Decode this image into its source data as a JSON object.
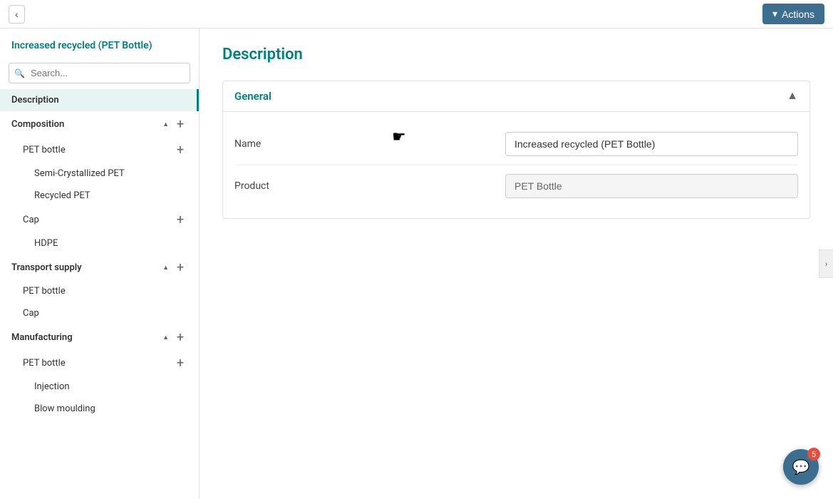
{
  "topbar": {
    "back_label": "‹",
    "actions_label": "Actions",
    "actions_icon": "▾"
  },
  "sidebar": {
    "title": "Increased recycled (PET Bottle)",
    "search_placeholder": "Search...",
    "nav": [
      {
        "id": "description",
        "label": "Description",
        "level": 0,
        "active": true,
        "has_plus": false,
        "chevron": null
      },
      {
        "id": "composition",
        "label": "Composition",
        "level": 0,
        "active": false,
        "has_plus": true,
        "chevron": "up"
      },
      {
        "id": "pet-bottle-1",
        "label": "PET bottle",
        "level": 1,
        "active": false,
        "has_plus": true,
        "chevron": null
      },
      {
        "id": "semi-crystallized-pet",
        "label": "Semi-Crystallized PET",
        "level": 2,
        "active": false,
        "has_plus": false,
        "chevron": null
      },
      {
        "id": "recycled-pet",
        "label": "Recycled PET",
        "level": 2,
        "active": false,
        "has_plus": false,
        "chevron": null
      },
      {
        "id": "cap-1",
        "label": "Cap",
        "level": 1,
        "active": false,
        "has_plus": true,
        "chevron": null
      },
      {
        "id": "hdpe",
        "label": "HDPE",
        "level": 2,
        "active": false,
        "has_plus": false,
        "chevron": null
      },
      {
        "id": "transport-supply",
        "label": "Transport supply",
        "level": 0,
        "active": false,
        "has_plus": true,
        "chevron": "up"
      },
      {
        "id": "pet-bottle-2",
        "label": "PET bottle",
        "level": 1,
        "active": false,
        "has_plus": false,
        "chevron": null
      },
      {
        "id": "cap-2",
        "label": "Cap",
        "level": 1,
        "active": false,
        "has_plus": false,
        "chevron": null
      },
      {
        "id": "manufacturing",
        "label": "Manufacturing",
        "level": 0,
        "active": false,
        "has_plus": true,
        "chevron": "up"
      },
      {
        "id": "pet-bottle-3",
        "label": "PET bottle",
        "level": 1,
        "active": false,
        "has_plus": true,
        "chevron": null
      },
      {
        "id": "injection",
        "label": "Injection",
        "level": 2,
        "active": false,
        "has_plus": false,
        "chevron": null
      },
      {
        "id": "blow-moulding",
        "label": "Blow moulding",
        "level": 2,
        "active": false,
        "has_plus": false,
        "chevron": null
      }
    ]
  },
  "content": {
    "title": "Description",
    "sections": [
      {
        "id": "general",
        "label": "General",
        "collapsed": false,
        "fields": [
          {
            "label": "Name",
            "value": "Increased recycled (PET Bottle)",
            "readonly": false,
            "placeholder": ""
          },
          {
            "label": "Product",
            "value": "PET Bottle",
            "readonly": true,
            "placeholder": "PET Bottle"
          }
        ]
      }
    ]
  },
  "chat": {
    "badge": "5",
    "icon": "💬"
  }
}
